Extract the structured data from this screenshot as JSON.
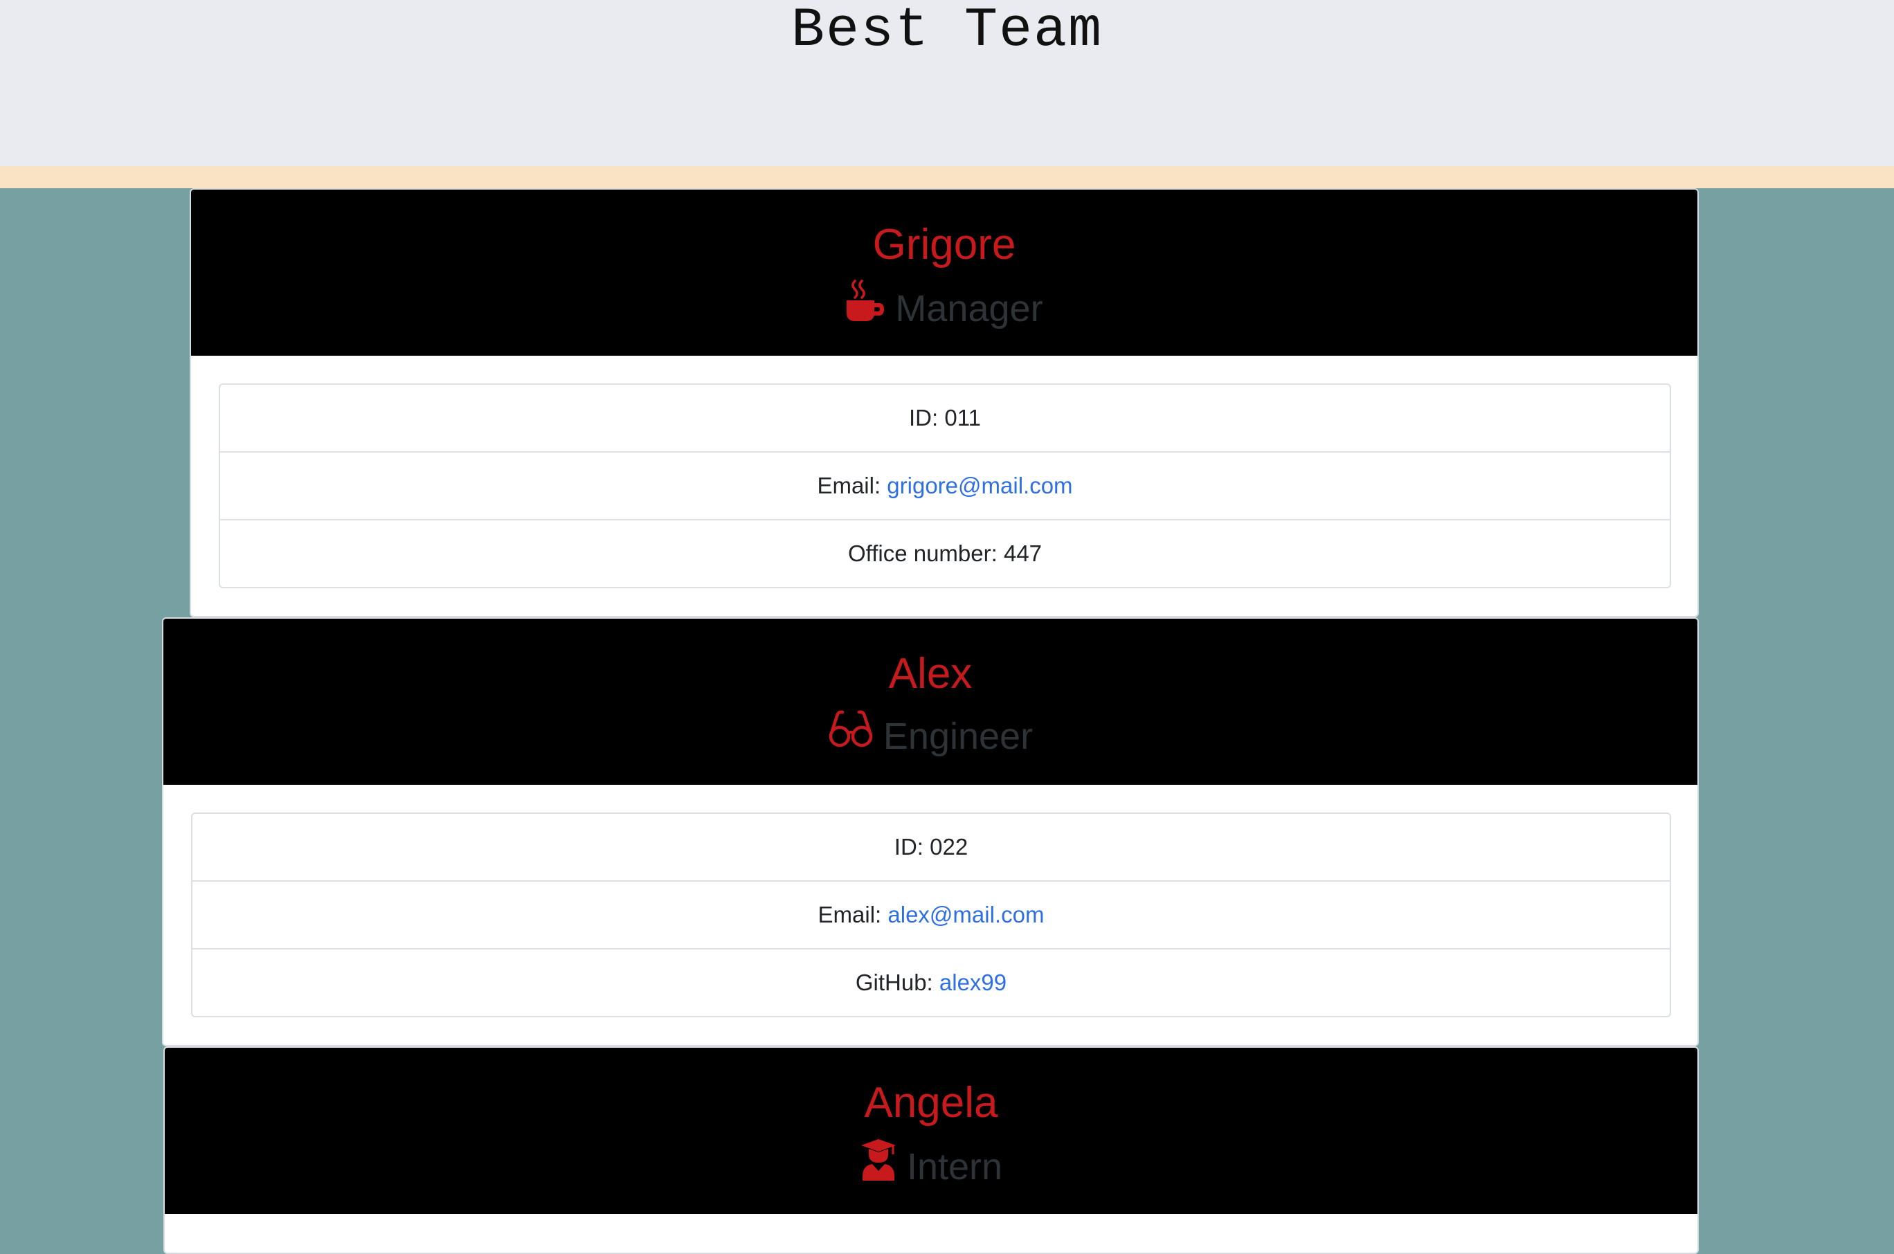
{
  "header": {
    "title": "Best Team"
  },
  "colors": {
    "page_background": "#76a0a1",
    "header_background": "#e9ebf0",
    "header_strip": "#f9e3c4",
    "card_head": "#000000",
    "name_red": "#c81a1c",
    "role_gray": "#2e3338",
    "link_blue": "#2f6fe4"
  },
  "employees": [
    {
      "name": "Grigore",
      "role": "Manager",
      "role_icon": "coffee-mug-icon",
      "id_label": "ID:",
      "id": "011",
      "email_label": "Email:",
      "email": "grigore@mail.com",
      "extra_label": "Office number:",
      "extra_value": "447"
    },
    {
      "name": "Alex",
      "role": "Engineer",
      "role_icon": "glasses-icon",
      "id_label": "ID:",
      "id": "022",
      "email_label": "Email:",
      "email": "alex@mail.com",
      "extra_label": "GitHub:",
      "extra_value": "alex99"
    },
    {
      "name": "Angela",
      "role": "Intern",
      "role_icon": "graduate-user-icon"
    }
  ]
}
